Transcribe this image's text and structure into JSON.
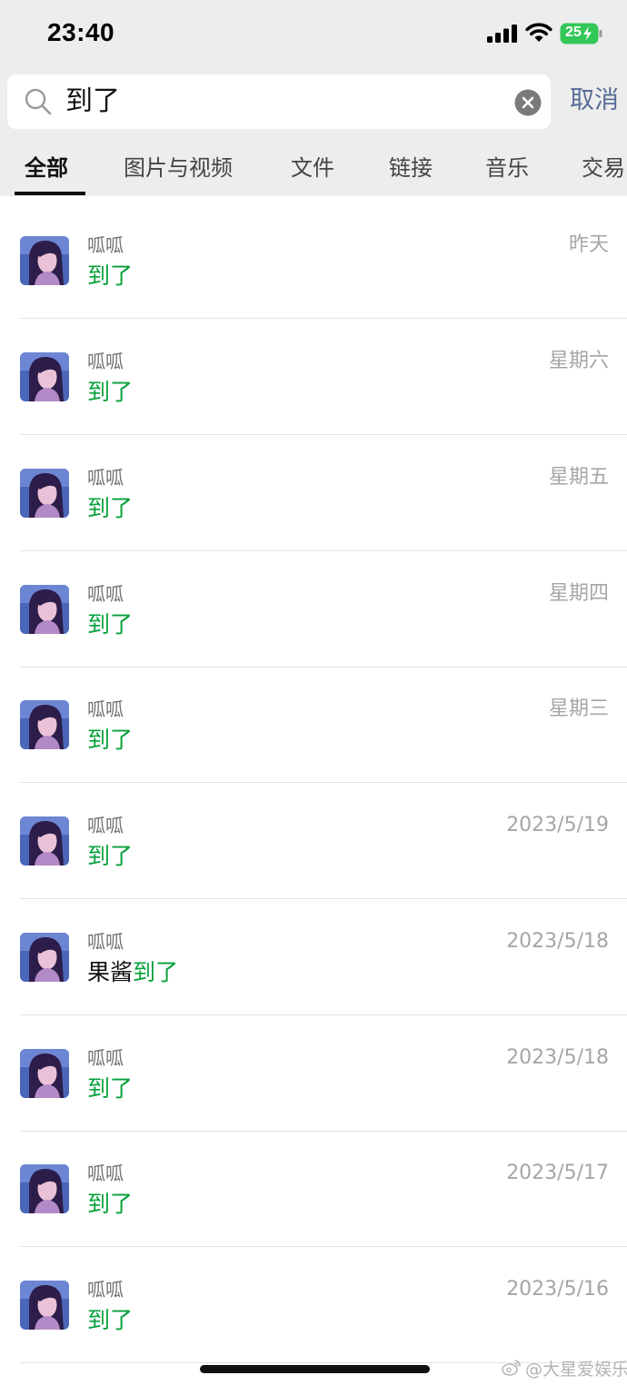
{
  "status_bar": {
    "time": "23:40",
    "battery": "25",
    "icons": [
      "signal-icon",
      "wifi-icon",
      "battery-icon"
    ]
  },
  "search": {
    "query": "到了",
    "cancel_label": "取消",
    "icons": [
      "search-icon",
      "clear-icon"
    ]
  },
  "tabs": [
    {
      "label": "全部",
      "active": true
    },
    {
      "label": "图片与视频"
    },
    {
      "label": "文件"
    },
    {
      "label": "链接"
    },
    {
      "label": "音乐"
    },
    {
      "label": "交易"
    }
  ],
  "results": [
    {
      "name": "呱呱",
      "prefix": "",
      "match": "到了",
      "date": "昨天"
    },
    {
      "name": "呱呱",
      "prefix": "",
      "match": "到了",
      "date": "星期六"
    },
    {
      "name": "呱呱",
      "prefix": "",
      "match": "到了",
      "date": "星期五"
    },
    {
      "name": "呱呱",
      "prefix": "",
      "match": "到了",
      "date": "星期四"
    },
    {
      "name": "呱呱",
      "prefix": "",
      "match": "到了",
      "date": "星期三"
    },
    {
      "name": "呱呱",
      "prefix": "",
      "match": "到了",
      "date": "2023/5/19"
    },
    {
      "name": "呱呱",
      "prefix": "果酱",
      "match": "到了",
      "date": "2023/5/18"
    },
    {
      "name": "呱呱",
      "prefix": "",
      "match": "到了",
      "date": "2023/5/18"
    },
    {
      "name": "呱呱",
      "prefix": "",
      "match": "到了",
      "date": "2023/5/17"
    },
    {
      "name": "呱呱",
      "prefix": "",
      "match": "到了",
      "date": "2023/5/16"
    }
  ],
  "watermark": "@大星爱娱乐",
  "colors": {
    "highlight": "#07a03a",
    "cancel": "#576b95",
    "header_bg": "#ededed",
    "battery": "#33c758"
  }
}
